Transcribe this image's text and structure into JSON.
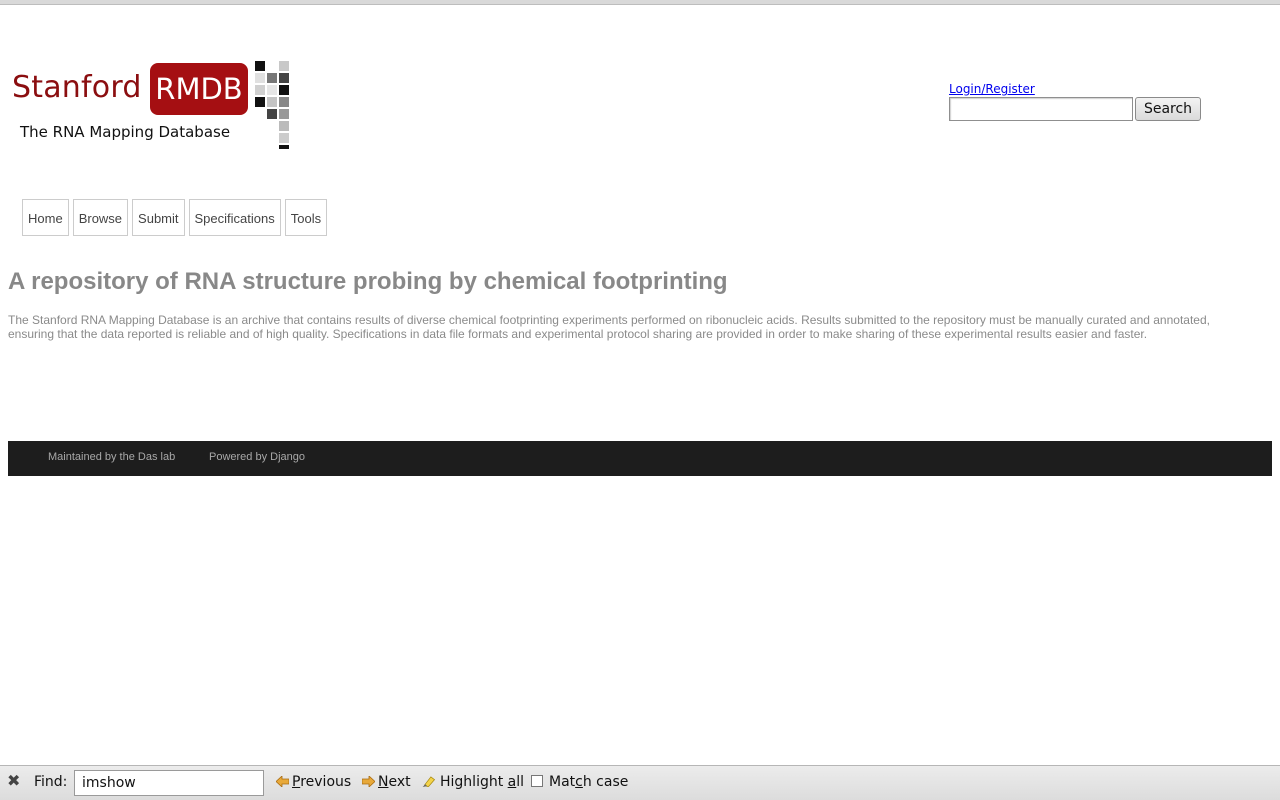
{
  "brand": {
    "word_left": "Stanford",
    "word_badge": "RMDB",
    "tagline": "The RNA Mapping Database",
    "colors": {
      "brand_red": "#a50f12",
      "brand_dark_red": "#8b0e10"
    }
  },
  "header": {
    "login_link": "Login/Register",
    "search": {
      "value": "",
      "placeholder": "",
      "button_label": "Search"
    }
  },
  "nav": {
    "items": [
      {
        "label": "Home"
      },
      {
        "label": "Browse"
      },
      {
        "label": "Submit"
      },
      {
        "label": "Specifications"
      },
      {
        "label": "Tools"
      }
    ]
  },
  "main": {
    "headline": "A repository of RNA structure probing by chemical footprinting",
    "description": "The Stanford RNA Mapping Database is an archive that contains results of diverse chemical footprinting experiments performed on ribonucleic acids. Results submitted to the repository must be manually curated and annotated, ensuring that the data reported is reliable and of high quality. Specifications in data file formats and experimental protocol sharing are provided in order to make sharing of these experimental results easier and faster."
  },
  "footer": {
    "maintained": "Maintained by the Das lab",
    "powered": "Powered by Django"
  },
  "findbar": {
    "label": "Find:",
    "query": "imshow",
    "previous": {
      "pre": "",
      "key": "P",
      "post": "revious"
    },
    "next": {
      "pre": "",
      "key": "N",
      "post": "ext"
    },
    "highlight_all": {
      "pre": "Highlight ",
      "key": "a",
      "post": "ll"
    },
    "match_case": {
      "pre": "Mat",
      "key": "c",
      "post": "h case",
      "checked": false
    },
    "close_icon": "close-x-icon"
  }
}
